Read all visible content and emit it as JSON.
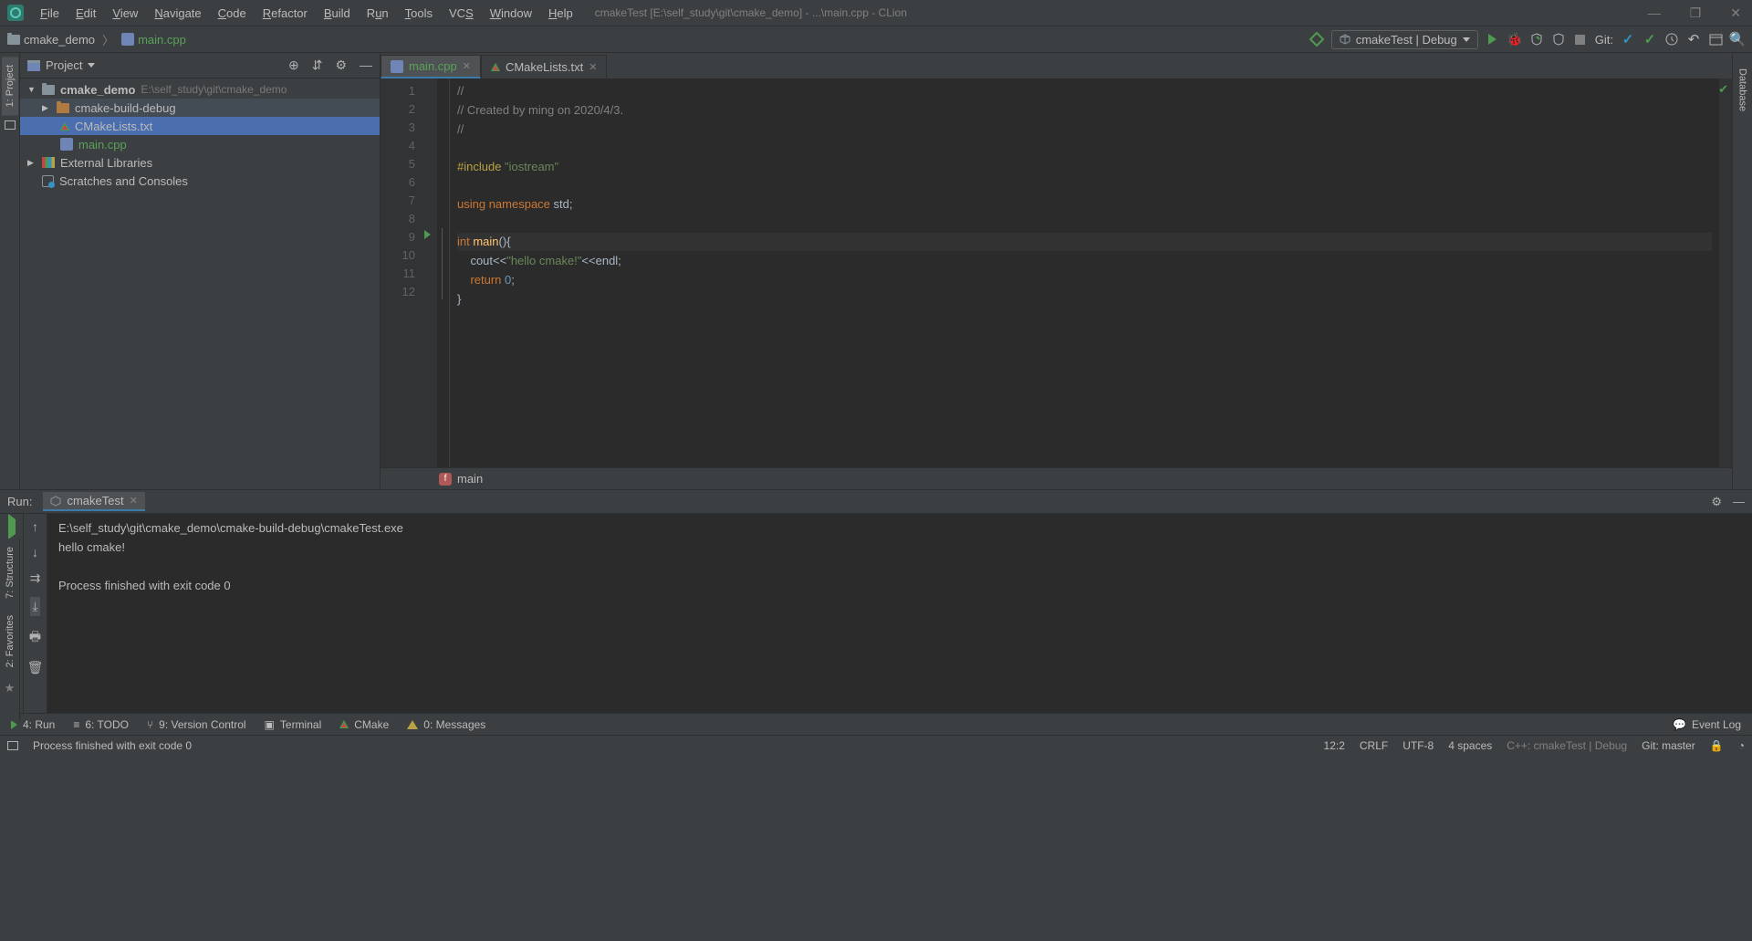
{
  "title": "cmakeTest [E:\\self_study\\git\\cmake_demo] - ...\\main.cpp - CLion",
  "menu": [
    "File",
    "Edit",
    "View",
    "Navigate",
    "Code",
    "Refactor",
    "Build",
    "Run",
    "Tools",
    "VCS",
    "Window",
    "Help"
  ],
  "breadcrumbs": {
    "root": "cmake_demo",
    "file": "main.cpp"
  },
  "run_config": "cmakeTest | Debug",
  "git_label": "Git:",
  "project_panel": {
    "title": "Project",
    "root": {
      "name": "cmake_demo",
      "path": "E:\\self_study\\git\\cmake_demo"
    },
    "items": [
      {
        "name": "cmake-build-debug"
      },
      {
        "name": "CMakeLists.txt"
      },
      {
        "name": "main.cpp"
      }
    ],
    "external": "External Libraries",
    "scratches": "Scratches and Consoles"
  },
  "editor_tabs": [
    {
      "name": "main.cpp",
      "icon": "cpp",
      "active": true
    },
    {
      "name": "CMakeLists.txt",
      "icon": "cmake",
      "active": false
    }
  ],
  "code": {
    "lines": [
      "1",
      "2",
      "3",
      "4",
      "5",
      "6",
      "7",
      "8",
      "9",
      "10",
      "11",
      "12"
    ],
    "l1": "//",
    "l2": "// Created by ming on 2020/4/3.",
    "l3": "//",
    "l5_a": "#include ",
    "l5_b": "\"iostream\"",
    "l7_a": "using ",
    "l7_b": "namespace ",
    "l7_c": "std",
    "l7_d": ";",
    "l9_a": "int ",
    "l9_b": "main",
    "l9_c": "(){",
    "l10_a": "    cout<<",
    "l10_b": "\"hello cmake!\"",
    "l10_c": "<<endl;",
    "l11_a": "    ",
    "l11_b": "return ",
    "l11_c": "0",
    "l11_d": ";",
    "l12": "}"
  },
  "code_breadcrumb": "main",
  "run_panel": {
    "label": "Run:",
    "tab": "cmakeTest",
    "console_l1": "E:\\self_study\\git\\cmake_demo\\cmake-build-debug\\cmakeTest.exe",
    "console_l2": "hello cmake!",
    "console_l3": "",
    "console_l4": "Process finished with exit code 0"
  },
  "left_tabs": {
    "project": "1: Project",
    "structure": "7: Structure",
    "favorites": "2: Favorites"
  },
  "right_tabs": {
    "database": "Database"
  },
  "bottom_tabs": {
    "run": "4: Run",
    "todo": "6: TODO",
    "vcs": "9: Version Control",
    "terminal": "Terminal",
    "cmake": "CMake",
    "messages": "0: Messages",
    "event_log": "Event Log"
  },
  "status": {
    "msg": "Process finished with exit code 0",
    "pos": "12:2",
    "eol": "CRLF",
    "encoding": "UTF-8",
    "indent": "4 spaces",
    "context": "C++: cmakeTest | Debug",
    "branch": "Git: master"
  }
}
